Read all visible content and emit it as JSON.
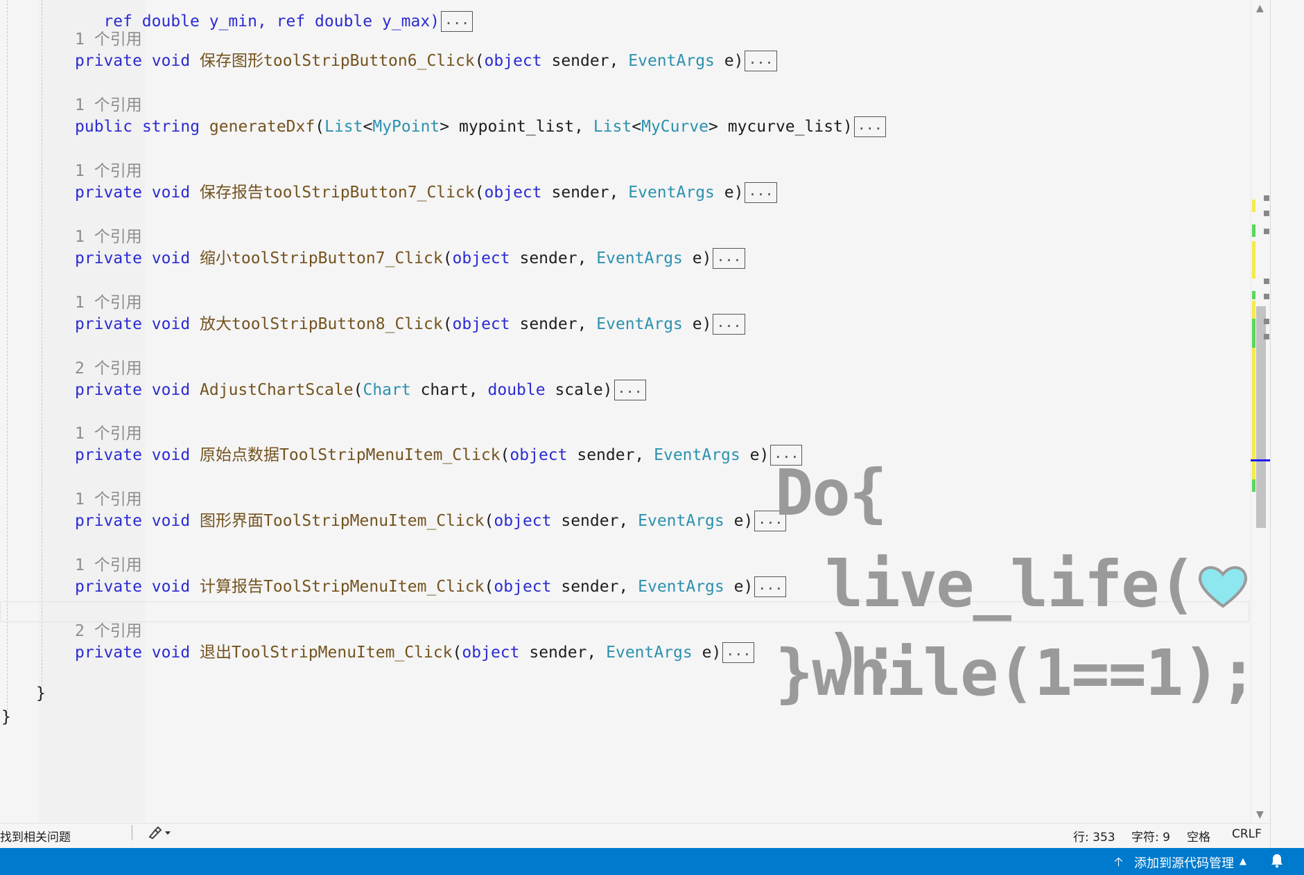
{
  "editor": {
    "top_fragment": "ref double y_min, ref double y_max)",
    "collapsed": "...",
    "methods": [
      {
        "refs": "1 个引用",
        "sig": [
          [
            "kw",
            "private"
          ],
          [
            "pl",
            " "
          ],
          [
            "kw",
            "void"
          ],
          [
            "pl",
            " "
          ],
          [
            "fn",
            "保存图形toolStripButton6_Click"
          ],
          [
            "pl",
            "("
          ],
          [
            "kw",
            "object"
          ],
          [
            "pl",
            " sender, "
          ],
          [
            "ty",
            "EventArgs"
          ],
          [
            "pl",
            " e)"
          ]
        ]
      },
      {
        "refs": "1 个引用",
        "sig": [
          [
            "kw",
            "public"
          ],
          [
            "pl",
            " "
          ],
          [
            "kw",
            "string"
          ],
          [
            "pl",
            " "
          ],
          [
            "fn",
            "generateDxf"
          ],
          [
            "pl",
            "("
          ],
          [
            "ty",
            "List"
          ],
          [
            "pl",
            "<"
          ],
          [
            "ty",
            "MyPoint"
          ],
          [
            "pl",
            "> mypoint_list, "
          ],
          [
            "ty",
            "List"
          ],
          [
            "pl",
            "<"
          ],
          [
            "ty",
            "MyCurve"
          ],
          [
            "pl",
            "> mycurve_list)"
          ]
        ]
      },
      {
        "refs": "1 个引用",
        "sig": [
          [
            "kw",
            "private"
          ],
          [
            "pl",
            " "
          ],
          [
            "kw",
            "void"
          ],
          [
            "pl",
            " "
          ],
          [
            "fn",
            "保存报告toolStripButton7_Click"
          ],
          [
            "pl",
            "("
          ],
          [
            "kw",
            "object"
          ],
          [
            "pl",
            " sender, "
          ],
          [
            "ty",
            "EventArgs"
          ],
          [
            "pl",
            " e)"
          ]
        ]
      },
      {
        "refs": "1 个引用",
        "sig": [
          [
            "kw",
            "private"
          ],
          [
            "pl",
            " "
          ],
          [
            "kw",
            "void"
          ],
          [
            "pl",
            " "
          ],
          [
            "fn",
            "缩小toolStripButton7_Click"
          ],
          [
            "pl",
            "("
          ],
          [
            "kw",
            "object"
          ],
          [
            "pl",
            " sender, "
          ],
          [
            "ty",
            "EventArgs"
          ],
          [
            "pl",
            " e)"
          ]
        ]
      },
      {
        "refs": "1 个引用",
        "sig": [
          [
            "kw",
            "private"
          ],
          [
            "pl",
            " "
          ],
          [
            "kw",
            "void"
          ],
          [
            "pl",
            " "
          ],
          [
            "fn",
            "放大toolStripButton8_Click"
          ],
          [
            "pl",
            "("
          ],
          [
            "kw",
            "object"
          ],
          [
            "pl",
            " sender, "
          ],
          [
            "ty",
            "EventArgs"
          ],
          [
            "pl",
            " e)"
          ]
        ]
      },
      {
        "refs": "2 个引用",
        "sig": [
          [
            "kw",
            "private"
          ],
          [
            "pl",
            " "
          ],
          [
            "kw",
            "void"
          ],
          [
            "pl",
            " "
          ],
          [
            "fn",
            "AdjustChartScale"
          ],
          [
            "pl",
            "("
          ],
          [
            "ty",
            "Chart"
          ],
          [
            "pl",
            " chart, "
          ],
          [
            "kw",
            "double"
          ],
          [
            "pl",
            " scale)"
          ]
        ]
      },
      {
        "refs": "1 个引用",
        "sig": [
          [
            "kw",
            "private"
          ],
          [
            "pl",
            " "
          ],
          [
            "kw",
            "void"
          ],
          [
            "pl",
            " "
          ],
          [
            "fn",
            "原始点数据ToolStripMenuItem_Click"
          ],
          [
            "pl",
            "("
          ],
          [
            "kw",
            "object"
          ],
          [
            "pl",
            " sender, "
          ],
          [
            "ty",
            "EventArgs"
          ],
          [
            "pl",
            " e)"
          ]
        ]
      },
      {
        "refs": "1 个引用",
        "sig": [
          [
            "kw",
            "private"
          ],
          [
            "pl",
            " "
          ],
          [
            "kw",
            "void"
          ],
          [
            "pl",
            " "
          ],
          [
            "fn",
            "图形界面ToolStripMenuItem_Click"
          ],
          [
            "pl",
            "("
          ],
          [
            "kw",
            "object"
          ],
          [
            "pl",
            " sender, "
          ],
          [
            "ty",
            "EventArgs"
          ],
          [
            "pl",
            " e)"
          ]
        ]
      },
      {
        "refs": "1 个引用",
        "sig": [
          [
            "kw",
            "private"
          ],
          [
            "pl",
            " "
          ],
          [
            "kw",
            "void"
          ],
          [
            "pl",
            " "
          ],
          [
            "fn",
            "计算报告ToolStripMenuItem_Click"
          ],
          [
            "pl",
            "("
          ],
          [
            "kw",
            "object"
          ],
          [
            "pl",
            " sender, "
          ],
          [
            "ty",
            "EventArgs"
          ],
          [
            "pl",
            " e)"
          ]
        ]
      },
      {
        "refs": "2 个引用",
        "sig": [
          [
            "kw",
            "private"
          ],
          [
            "pl",
            " "
          ],
          [
            "kw",
            "void"
          ],
          [
            "pl",
            " "
          ],
          [
            "fn",
            "退出ToolStripMenuItem_Click"
          ],
          [
            "pl",
            "("
          ],
          [
            "kw",
            "object"
          ],
          [
            "pl",
            " sender, "
          ],
          [
            "ty",
            "EventArgs"
          ],
          [
            "pl",
            " e)"
          ]
        ]
      }
    ],
    "inner_brace": "}",
    "outer_brace": "}"
  },
  "watermark": {
    "line1": "Do{",
    "line2": "live_life(",
    "line2_end": ");",
    "line3": "}while(1==1);",
    "heart_color": "#8ee6ee"
  },
  "infobar": {
    "issues": "找到相关问题",
    "tool_icon": "brush-icon",
    "line": "行: 353",
    "char": "字符: 9",
    "spaces": "空格",
    "eol": "CRLF"
  },
  "statusbar": {
    "source_control": "添加到源代码管理",
    "bell_icon": "bell-icon",
    "color": "#007acc"
  },
  "colors": {
    "keyword": "#2b2bd1",
    "type": "#2b91af",
    "method": "#74531f",
    "reference": "#8c8c8c"
  }
}
